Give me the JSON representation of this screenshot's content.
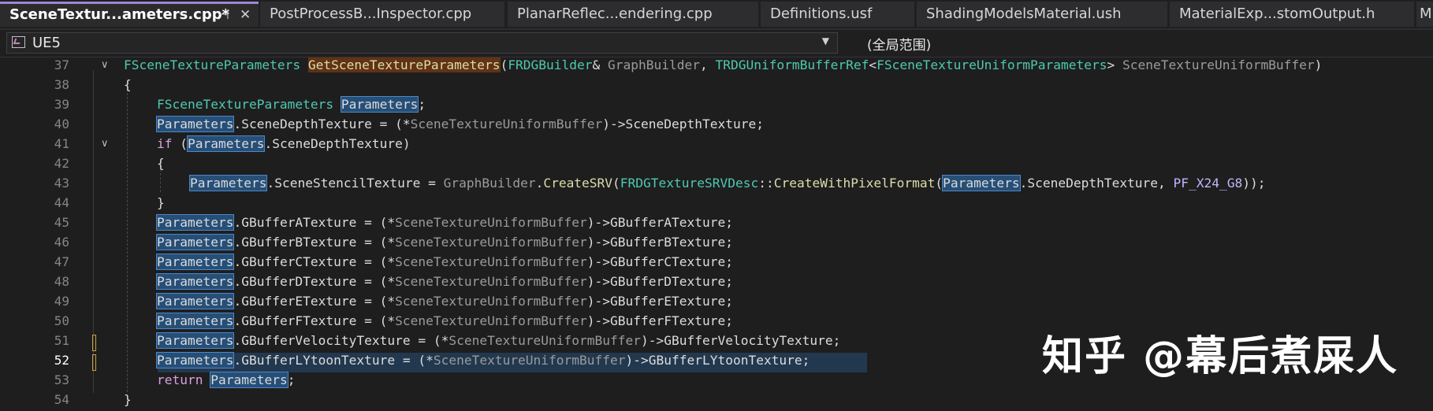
{
  "tabs": [
    {
      "label": "SceneTextur...ameters.cpp*",
      "active": true
    },
    {
      "label": "PostProcessB...Inspector.cpp"
    },
    {
      "label": "PlanarReflec...endering.cpp"
    },
    {
      "label": "Definitions.usf"
    },
    {
      "label": "ShadingModelsMaterial.ush"
    },
    {
      "label": "MaterialExp...stomOutput.h"
    },
    {
      "label": "M"
    }
  ],
  "tab_pin_icon": "⊣",
  "tab_close_icon": "✕",
  "nav": {
    "project": "UE5",
    "scope": "(全局范围)",
    "dropdown_icon": "chevron-down-icon"
  },
  "code": {
    "lines": [
      "37",
      "38",
      "39",
      "40",
      "41",
      "42",
      "43",
      "44",
      "45",
      "46",
      "47",
      "48",
      "49",
      "50",
      "51",
      "52",
      "53",
      "54"
    ],
    "l37": [
      "FSceneTextureParameters",
      " ",
      "GetSceneTextureParameters",
      "(",
      "FRDGBuilder",
      "& ",
      "GraphBuilder",
      ", ",
      "TRDGUniformBufferRef",
      "<",
      "FSceneTextureUniformParameters",
      "> ",
      "SceneTextureUniformBuffer",
      ")"
    ],
    "l38": "{",
    "l39": [
      "FSceneTextureParameters",
      " ",
      "Parameters",
      ";"
    ],
    "l40": [
      "Parameters",
      ".SceneDepthTexture = (*",
      "SceneTextureUniformBuffer",
      ")->SceneDepthTexture;"
    ],
    "l41": [
      "if",
      " (",
      "Parameters",
      ".SceneDepthTexture)"
    ],
    "l42": "{",
    "l43": [
      "Parameters",
      ".SceneStencilTexture = ",
      "GraphBuilder",
      ".",
      "CreateSRV",
      "(",
      "FRDGTextureSRVDesc",
      "::",
      "CreateWithPixelFormat",
      "(",
      "Parameters",
      ".SceneDepthTexture, ",
      "PF_X24_G8",
      "));"
    ],
    "l44": "}",
    "buffers": [
      [
        "Parameters",
        ".GBufferATexture = (*",
        "SceneTextureUniformBuffer",
        ")->GBufferATexture;"
      ],
      [
        "Parameters",
        ".GBufferBTexture = (*",
        "SceneTextureUniformBuffer",
        ")->GBufferBTexture;"
      ],
      [
        "Parameters",
        ".GBufferCTexture = (*",
        "SceneTextureUniformBuffer",
        ")->GBufferCTexture;"
      ],
      [
        "Parameters",
        ".GBufferDTexture = (*",
        "SceneTextureUniformBuffer",
        ")->GBufferDTexture;"
      ],
      [
        "Parameters",
        ".GBufferETexture = (*",
        "SceneTextureUniformBuffer",
        ")->GBufferETexture;"
      ],
      [
        "Parameters",
        ".GBufferFTexture = (*",
        "SceneTextureUniformBuffer",
        ")->GBufferFTexture;"
      ],
      [
        "Parameters",
        ".GBufferVelocityTexture = (*",
        "SceneTextureUniformBuffer",
        ")->GBufferVelocityTexture;"
      ],
      [
        "Parameters",
        ".GBufferLYtoonTexture = (*",
        "SceneTextureUniformBuffer",
        ")->GBufferLYtoonTexture;"
      ]
    ],
    "l53": [
      "return",
      " ",
      "Parameters",
      ";"
    ],
    "l54": "}",
    "current_line": "52"
  },
  "watermark": "知乎 @幕后煮屎人",
  "colors": {
    "type": "#4ec9b0",
    "function": "#dcdcaa",
    "keyword": "#d8a0df",
    "macro": "#beb7ff",
    "selection": "#264f78",
    "active_tab_border": "#9e86d6"
  }
}
